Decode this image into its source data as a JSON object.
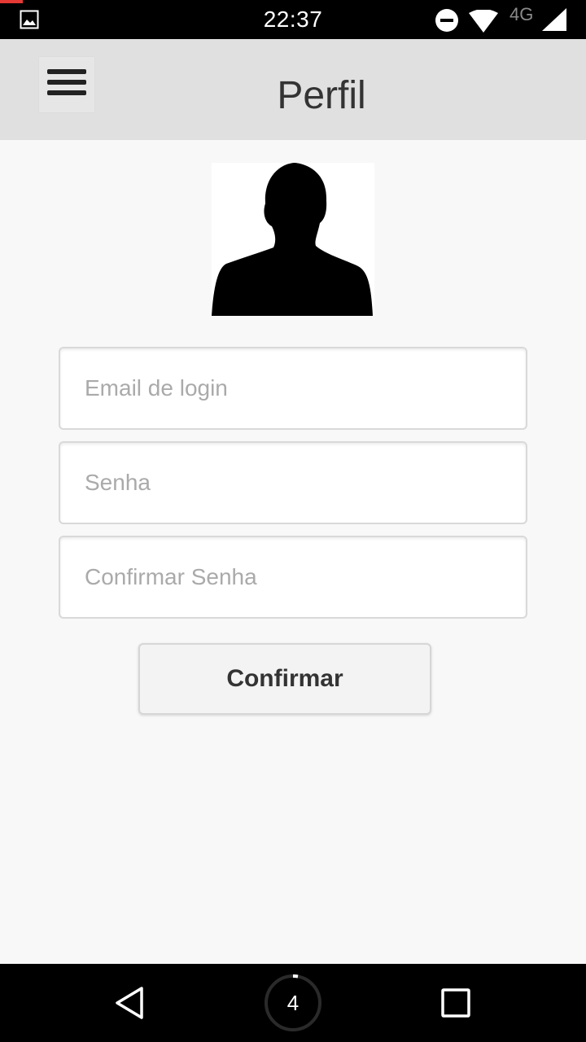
{
  "status_bar": {
    "time": "22:37",
    "network": "4G",
    "icons": [
      "gallery-icon",
      "do-not-disturb-icon",
      "wifi-icon",
      "signal-icon"
    ]
  },
  "header": {
    "title": "Perfil",
    "menu_icon": "hamburger-menu-icon"
  },
  "form": {
    "email_placeholder": "Email de login",
    "senha_placeholder": "Senha",
    "confirmar_senha_placeholder": "Confirmar Senha",
    "confirm_label": "Confirmar"
  },
  "nav_bar": {
    "home_badge": "4",
    "icons": [
      "back-icon",
      "home-icon",
      "recents-icon"
    ]
  },
  "colors": {
    "header_bg": "#e0e0e0",
    "page_bg": "#f8f8f8",
    "status_bar_bg": "#000000"
  }
}
